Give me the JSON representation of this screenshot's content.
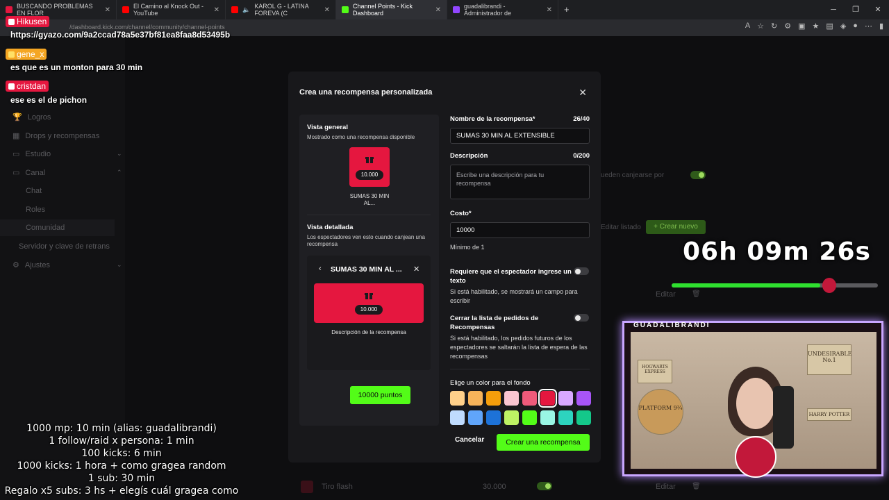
{
  "browser": {
    "tabs": [
      {
        "label": "BUSCANDO PROBLEMAS EN FLOR",
        "color": "#e5173f"
      },
      {
        "label": "El Camino al Knock Out - YouTube",
        "color": "#ff0000"
      },
      {
        "label": "KAROL G - LATINA FOREVA (C",
        "color": "#ff0000"
      },
      {
        "label": "Channel Points - Kick Dashboard",
        "color": "#53fc18"
      },
      {
        "label": "guadalibrandi - Administrador de",
        "color": "#9146ff"
      }
    ],
    "url": "/dashboard.kick.com/channel/community/channel-points"
  },
  "chat": [
    {
      "name": "Hikusen",
      "badge_color": "#e5173f",
      "message": "https://gyazo.com/9a2ccad78a5e37bf81ea8faa8d53495b"
    },
    {
      "name": "gene_x",
      "badge_color": "#f5a623",
      "message": "es que es un monton para 30 min"
    },
    {
      "name": "cristdan",
      "badge_color": "#e5173f",
      "message": "ese es el de pichon"
    }
  ],
  "sidebar": {
    "items": [
      {
        "label": "Logros"
      },
      {
        "label": "Drops y recompensas"
      },
      {
        "label": "Estudio"
      },
      {
        "label": "Canal"
      },
      {
        "label": "Chat"
      },
      {
        "label": "Roles"
      },
      {
        "label": "Comunidad"
      },
      {
        "label": "Servidor y clave de retrans"
      },
      {
        "label": "Ajustes"
      }
    ]
  },
  "background": {
    "redeem_label": "ueden canjearse por",
    "edit_list": "Editar listado",
    "create_new": "Crear nuevo",
    "edit1": "Editar",
    "row_name": "Tiro flash",
    "row_cost": "30.000",
    "edit2": "Editar"
  },
  "modal": {
    "title": "Crea una recompensa personalizada",
    "overview": {
      "title": "Vista general",
      "subtitle": "Mostrado como una recompensa disponible",
      "cost": "10.000",
      "name": "SUMAS 30 MIN AL..."
    },
    "detail": {
      "title": "Vista detallada",
      "subtitle": "Los espectadores ven esto cuando canjean una recompensa",
      "header": "SUMAS 30 MIN AL ...",
      "cost": "10.000",
      "description": "Descripción de la recompensa",
      "points_button": "10000 puntos"
    },
    "form": {
      "name_label": "Nombre de la recompensa*",
      "name_counter": "26/40",
      "name_value": "SUMAS 30 MIN AL EXTENSIBLE",
      "desc_label": "Descripción",
      "desc_counter": "0/200",
      "desc_placeholder": "Escribe una descripción para tu recompensa",
      "cost_label": "Costo*",
      "cost_value": "10000",
      "cost_hint": "Mínimo de 1",
      "req_text_label": "Requiere que el espectador ingrese un texto",
      "req_text_hint": "Si está habilitado, se mostrará un campo para escribir",
      "close_list_label": "Cerrar la lista de pedidos de Recompensas",
      "close_list_hint": "Si está habilitado, los pedidos futuros de los espectadores se saltarán la lista de espera de las recompensas",
      "color_label": "Elige un color para el fondo",
      "colors_row1": [
        "#ffd08a",
        "#f7b45a",
        "#f59e0b",
        "#f9c5d1",
        "#ee5a7a",
        "#e5173f",
        "#d9a8ff",
        "#a855f7"
      ],
      "colors_row2": [
        "#bfdbfe",
        "#60a5fa",
        "#1d72d8",
        "#bef264",
        "#53fc18",
        "#99f6e4",
        "#2dd4bf",
        "#14c88a"
      ],
      "selected_color": "#e5173f"
    },
    "cancel": "Cancelar",
    "create": "Crear una recompensa"
  },
  "overlay": {
    "timer": "06h 09m 26s",
    "progress": 0.72,
    "webcam_name": "GUADALIBRANDI",
    "posters": [
      "HOGWARTS EXPRESS",
      "PLATFORM 9¾",
      "UNDESIRABLE No.1",
      "HARRY POTTER"
    ],
    "rules": [
      "1000 mp: 10 min (alias: guadalibrandi)",
      "1 follow/raid x persona: 1 min",
      "100 kicks: 6 min",
      "1000 kicks: 1 hora + como gragea random",
      "1 sub: 30 min",
      "Regalo x5 subs: 3 hs + elegís cuál gragea como"
    ]
  }
}
